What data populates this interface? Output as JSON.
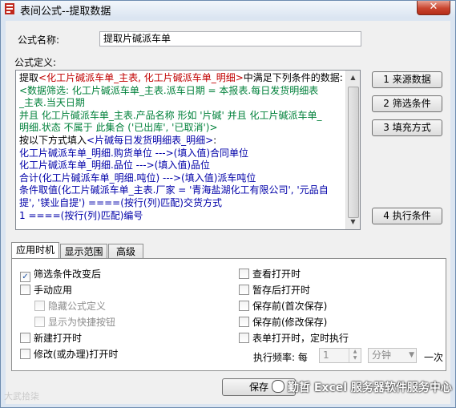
{
  "window": {
    "title": "表间公式--提取数据",
    "close_label": "✕"
  },
  "form": {
    "name_label": "公式名称:",
    "name_value": "提取片碱派车单",
    "definition_label": "公式定义:"
  },
  "formula": {
    "lines": [
      [
        {
          "t": "提取",
          "c": "black"
        },
        {
          "t": "<化工片碱派车单_主表, 化工片碱派车单_明细>",
          "c": "red"
        },
        {
          "t": "中满足下列条件的数据:",
          "c": "black"
        }
      ],
      [
        {
          "t": "    <数据筛选: 化工片碱派车单_主表.派车日期 = 本报表.每日发货明细表",
          "c": "green"
        }
      ],
      [
        {
          "t": "_主表.当天日期",
          "c": "green"
        }
      ],
      [
        {
          "t": " 并且 化工片碱派车单_主表.产品名称 形如 '片碱' 并且 化工片碱派车单_",
          "c": "green"
        }
      ],
      [
        {
          "t": "明细.状态 不属于 此集合 ('已出库', '已取消')>",
          "c": "green"
        }
      ],
      [
        {
          "t": "按以下方式填入",
          "c": "black"
        },
        {
          "t": "<片碱每日发货明细表_明细>",
          "c": "blue"
        },
        {
          "t": ":",
          "c": "black"
        }
      ],
      [
        {
          "t": "化工片碱派车单_明细.购货单位  --->(填入值)合同单位",
          "c": "blue"
        }
      ],
      [
        {
          "t": "化工片碱派车单_明细.品位  --->(填入值)品位",
          "c": "blue"
        }
      ],
      [
        {
          "t": "合计(化工片碱派车单_明细.吨位)  --->(填入值)派车吨位",
          "c": "blue"
        }
      ],
      [
        {
          "t": "条件取值(化工片碱派车单_主表.厂家 = '青海盐湖化工有限公司', '元品自",
          "c": "blue"
        }
      ],
      [
        {
          "t": "提', '镁业自提')  ====(按行(列)匹配)交货方式",
          "c": "blue"
        }
      ],
      [
        {
          "t": "1  ====(按行(列)匹配)编号",
          "c": "blue"
        }
      ]
    ]
  },
  "side_buttons": [
    "1  来源数据",
    "2  筛选条件",
    "3  填充方式",
    "4  执行条件"
  ],
  "tabs": [
    "应用时机",
    "显示范围",
    "高级"
  ],
  "options_left": [
    {
      "label": "筛选条件改变后",
      "checked": true,
      "enabled": true
    },
    {
      "label": "手动应用",
      "checked": false,
      "enabled": true
    },
    {
      "label": "隐藏公式定义",
      "checked": false,
      "enabled": false
    },
    {
      "label": "显示为快捷按钮",
      "checked": false,
      "enabled": false
    },
    {
      "label": "新建打开时",
      "checked": false,
      "enabled": true
    },
    {
      "label": "修改(或办理)打开时",
      "checked": false,
      "enabled": true
    }
  ],
  "options_right": [
    {
      "label": "查看打开时",
      "checked": false,
      "enabled": true
    },
    {
      "label": "暂存后打开时",
      "checked": false,
      "enabled": true
    },
    {
      "label": "保存前(首次保存)",
      "checked": false,
      "enabled": true
    },
    {
      "label": "保存前(修改保存)",
      "checked": false,
      "enabled": true
    },
    {
      "label": "表单打开时，定时执行",
      "checked": false,
      "enabled": true
    }
  ],
  "frequency": {
    "label": "执行频率: 每",
    "value": "1",
    "unit": "分钟",
    "suffix": "一次"
  },
  "footer": {
    "save_label": "保存",
    "watermark_left": "大武拾柒",
    "watermark_right": "勤哲 Excel 服务器软件服务中心"
  },
  "colors": {
    "red": "#c00000",
    "green": "#00803a",
    "blue": "#0000a8"
  }
}
